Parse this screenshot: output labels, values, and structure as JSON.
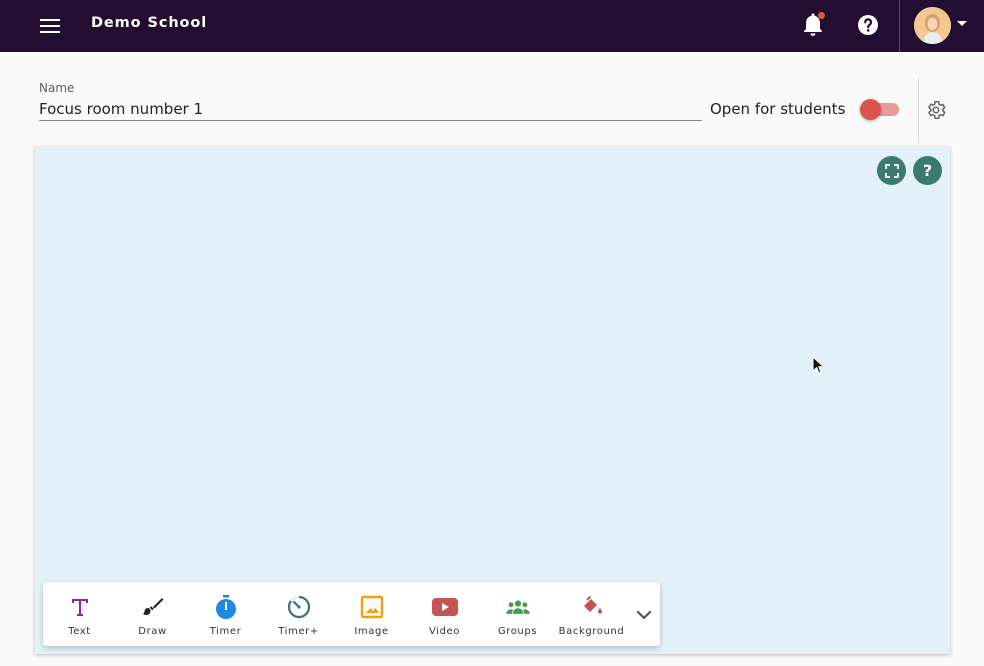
{
  "app": {
    "school_name": "Demo School"
  },
  "header": {
    "icons": [
      "menu-icon",
      "bell-icon",
      "help-icon",
      "avatar",
      "caret-down-icon"
    ],
    "notification_dot_color": "#e4572e"
  },
  "form": {
    "name_label": "Name",
    "name_value": "Focus room number 1",
    "open_label": "Open for students",
    "open_toggle_state": "off"
  },
  "canvas": {
    "background_color": "#e2f2f8",
    "help_label": "?"
  },
  "toolbar": {
    "tools": [
      {
        "label": "Text",
        "icon": "text-icon",
        "color": "#8e24aa"
      },
      {
        "label": "Draw",
        "icon": "brush-icon",
        "color": "#222222"
      },
      {
        "label": "Timer",
        "icon": "stopwatch-icon",
        "color": "#1e88e5"
      },
      {
        "label": "Timer+",
        "icon": "timer-plus-icon",
        "color": "#3c6e8f"
      },
      {
        "label": "Image",
        "icon": "image-icon",
        "color": "#f59e0b"
      },
      {
        "label": "Video",
        "icon": "video-icon",
        "color": "#c75454"
      },
      {
        "label": "Groups",
        "icon": "groups-icon",
        "color": "#43a047"
      },
      {
        "label": "Background",
        "icon": "paint-bucket-icon",
        "color": "#c75454"
      }
    ]
  }
}
